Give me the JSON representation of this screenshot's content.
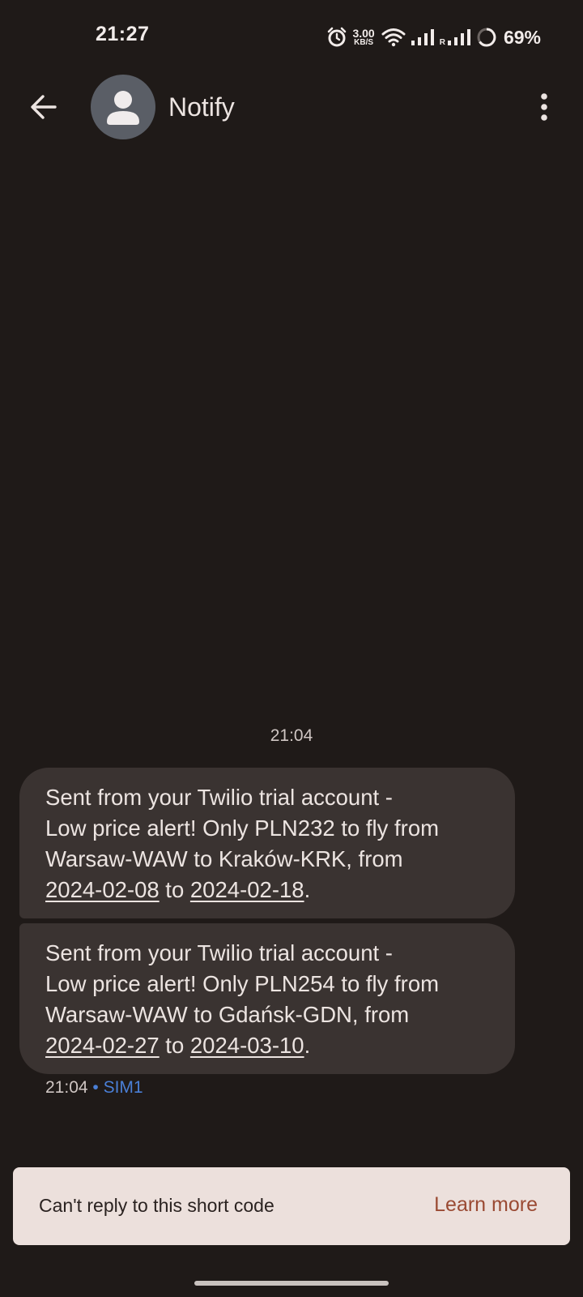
{
  "status_bar": {
    "time": "21:27",
    "net_speed_value": "3.00",
    "net_speed_unit": "KB/S",
    "roaming_indicator": "R",
    "battery": "69%",
    "icons": [
      "alarm-icon",
      "wifi-icon",
      "signal-icon",
      "signal-icon",
      "battery-icon"
    ]
  },
  "app_bar": {
    "contact_name": "Notify",
    "back_icon": "arrow-back-icon",
    "more_icon": "more-vert-icon",
    "avatar_icon": "person-icon"
  },
  "conversation": {
    "timestamp": "21:04",
    "messages": [
      {
        "line1": "Sent from your Twilio trial account -",
        "line2": "Low price alert! Only PLN232 to fly from",
        "line3": "Warsaw-WAW to Kraków-KRK, from",
        "date_from": "2024-02-08",
        "to_word": " to ",
        "date_to": "2024-02-18",
        "end": "."
      },
      {
        "line1": "Sent from your Twilio trial account -",
        "line2": "Low price alert! Only PLN254 to fly from",
        "line3": "Warsaw-WAW to Gdańsk-GDN, from",
        "date_from": "2024-02-27",
        "to_word": " to ",
        "date_to": "2024-03-10",
        "end": "."
      }
    ],
    "meta_time": "21:04",
    "meta_separator": " • ",
    "meta_sim": "SIM1"
  },
  "reply_banner": {
    "text": "Can't reply to this short code",
    "action": "Learn more"
  },
  "colors": {
    "background": "#1f1a18",
    "bubble": "#3a3331",
    "banner": "#ece0dc",
    "link": "#9a4a33",
    "sim": "#4a7fd6"
  }
}
